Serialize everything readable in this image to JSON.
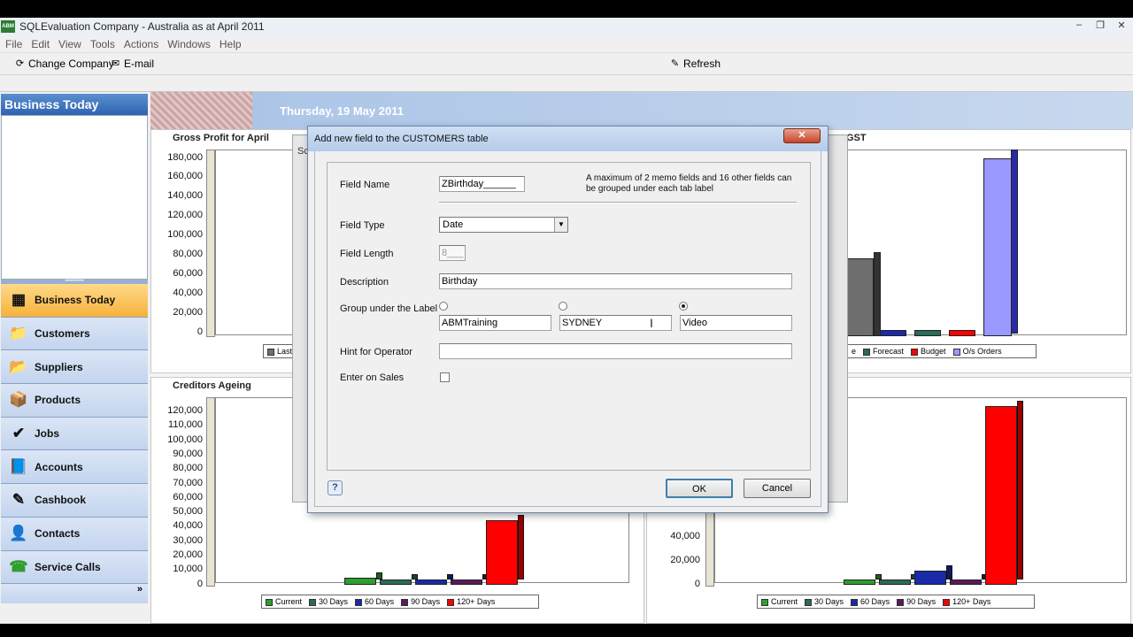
{
  "window": {
    "app_icon_text": "ABM",
    "title": "SQLEvaluation Company - Australia as at April 2011",
    "controls": {
      "minimize": "–",
      "restore": "❐",
      "close": "✕"
    }
  },
  "menu": [
    "File",
    "Edit",
    "View",
    "Tools",
    "Actions",
    "Windows",
    "Help"
  ],
  "toolbar": {
    "change_company": "Change Company",
    "email": "E-mail",
    "refresh": "Refresh"
  },
  "sidebar": {
    "header": "Business Today",
    "items": [
      {
        "label": "Business Today",
        "icon": "calendar-icon",
        "glyph": "▦"
      },
      {
        "label": "Customers",
        "icon": "folder-person-icon",
        "glyph": "📁"
      },
      {
        "label": "Suppliers",
        "icon": "folder-truck-icon",
        "glyph": "📂"
      },
      {
        "label": "Products",
        "icon": "boxes-icon",
        "glyph": "📦"
      },
      {
        "label": "Jobs",
        "icon": "checklist-icon",
        "glyph": "✔"
      },
      {
        "label": "Accounts",
        "icon": "ledger-icon",
        "glyph": "📘"
      },
      {
        "label": "Cashbook",
        "icon": "pen-paper-icon",
        "glyph": "✎"
      },
      {
        "label": "Contacts",
        "icon": "contact-card-icon",
        "glyph": "👤"
      },
      {
        "label": "Service Calls",
        "icon": "phone-icon",
        "glyph": "☎"
      }
    ],
    "more_glyph": "»"
  },
  "banner": {
    "date": "Thursday, 19 May 2011"
  },
  "charts": {
    "gross_profit": {
      "title": "Gross Profit for April",
      "yticks": [
        "180,000",
        "160,000",
        "140,000",
        "120,000",
        "100,000",
        "80,000",
        "60,000",
        "40,000",
        "20,000",
        "0"
      ],
      "legend_visible": "Last"
    },
    "sales_gst": {
      "title_visible": "GST",
      "legend": [
        "e",
        "Forecast",
        "Budget",
        "O/s Orders"
      ]
    },
    "creditors": {
      "title": "Creditors Ageing",
      "yticks": [
        "120,000",
        "110,000",
        "100,000",
        "90,000",
        "80,000",
        "70,000",
        "60,000",
        "50,000",
        "40,000",
        "30,000",
        "20,000",
        "10,000",
        "0"
      ],
      "legend": [
        "Current",
        "30 Days",
        "60 Days",
        "90 Days",
        "120+ Days"
      ]
    },
    "debtors": {
      "yticks": [
        "40,000",
        "20,000",
        "0"
      ],
      "legend": [
        "Current",
        "30 Days",
        "60 Days",
        "90 Days",
        "120+ Days"
      ]
    }
  },
  "colors": {
    "current": "#2e9e2e",
    "d30": "#2a6a5a",
    "d60": "#1a2aa8",
    "d90": "#5a1a5a",
    "d120": "#ff0000",
    "os_orders": "#9999ff",
    "last": "#707070"
  },
  "chart_data": [
    {
      "type": "bar",
      "title": "Creditors Ageing",
      "categories": [
        "Current",
        "30 Days",
        "60 Days",
        "90 Days",
        "120+ Days"
      ],
      "values": [
        5000,
        4000,
        3000,
        2000,
        45000
      ]
    },
    {
      "type": "bar",
      "categories": [
        "Current",
        "30 Days",
        "60 Days",
        "90 Days",
        "120+ Days"
      ],
      "values": [
        3000,
        4000,
        10000,
        1500,
        125000
      ],
      "ylim": [
        0,
        130000
      ]
    }
  ],
  "bg_dialog": {
    "title_fragment": "Sc"
  },
  "dialog": {
    "title": "Add new field to the CUSTOMERS table",
    "close_glyph": "✕",
    "field_name_label": "Field Name",
    "field_name_value": "ZBirthday______",
    "limit_note": "A maximum of 2 memo fields and 16 other fields can be grouped under each tab label",
    "field_type_label": "Field Type",
    "field_type_value": "Date",
    "field_length_label": "Field Length",
    "field_length_value": "8___",
    "description_label": "Description",
    "description_value": "Birthday",
    "group_label": "Group under the Label",
    "groups": [
      "ABMTraining",
      "SYDNEY",
      "Video"
    ],
    "selected_group": "Video",
    "hint_label": "Hint for Operator",
    "hint_value": "",
    "enter_on_sales_label": "Enter on Sales",
    "help_glyph": "?",
    "ok": "OK",
    "cancel": "Cancel"
  }
}
